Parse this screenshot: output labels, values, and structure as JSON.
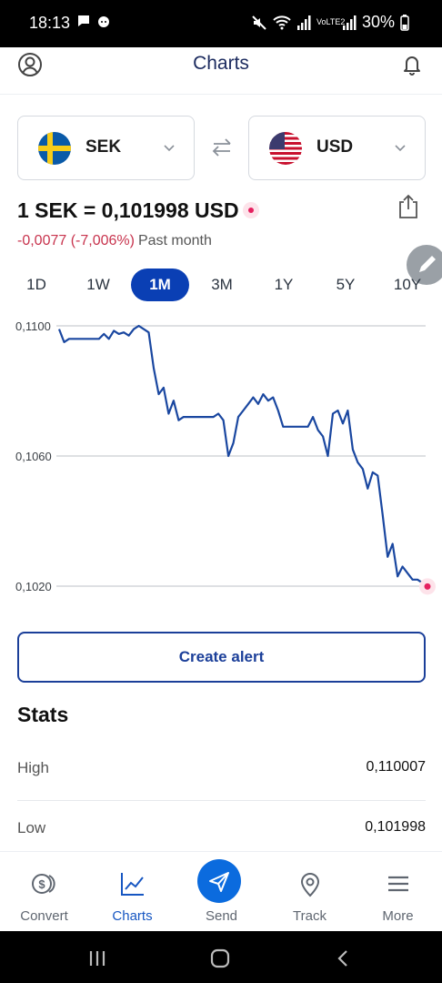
{
  "status_bar": {
    "time": "18:13",
    "battery": "30%",
    "network_label": "VoLTE2"
  },
  "header": {
    "title": "Charts"
  },
  "converter": {
    "from_currency": "SEK",
    "to_currency": "USD"
  },
  "rate": {
    "text": "1 SEK = 0,101998 USD",
    "change": "-0,0077 (-7,006%)",
    "period_label": "Past month"
  },
  "tabs": [
    {
      "label": "1D",
      "active": false
    },
    {
      "label": "1W",
      "active": false
    },
    {
      "label": "1M",
      "active": true
    },
    {
      "label": "3M",
      "active": false
    },
    {
      "label": "1Y",
      "active": false
    },
    {
      "label": "5Y",
      "active": false
    },
    {
      "label": "10Y",
      "active": false
    }
  ],
  "chart_data": {
    "type": "line",
    "ylim": [
      0.102,
      0.11
    ],
    "yticks": [
      "0,1100",
      "0,1060",
      "0,1020"
    ],
    "ytick_values": [
      0.11,
      0.106,
      0.102
    ],
    "series": [
      {
        "color": "#1a47a0",
        "values": [
          0.1099,
          0.1095,
          0.1096,
          0.1096,
          0.1096,
          0.1096,
          0.1096,
          0.1096,
          0.1096,
          0.10975,
          0.1096,
          0.10985,
          0.10975,
          0.1098,
          0.1097,
          0.1099,
          0.11,
          0.1099,
          0.1098,
          0.1087,
          0.1079,
          0.1081,
          0.1073,
          0.1077,
          0.1071,
          0.1072,
          0.1072,
          0.1072,
          0.1072,
          0.1072,
          0.1072,
          0.1072,
          0.1073,
          0.1071,
          0.106,
          0.1064,
          0.1072,
          0.1074,
          0.1076,
          0.1078,
          0.1076,
          0.1079,
          0.1077,
          0.1078,
          0.1074,
          0.1069,
          0.1069,
          0.1069,
          0.1069,
          0.1069,
          0.1069,
          0.1072,
          0.1068,
          0.1066,
          0.106,
          0.1073,
          0.1074,
          0.107,
          0.1074,
          0.1062,
          0.1058,
          0.1056,
          0.105,
          0.1055,
          0.1054,
          0.1042,
          0.1029,
          0.1033,
          0.1023,
          0.1026,
          0.1024,
          0.1022,
          0.1022,
          0.1021,
          0.10199
        ]
      }
    ],
    "last_point_marker_color": "#e5205f"
  },
  "actions": {
    "create_alert": "Create alert"
  },
  "stats": {
    "title": "Stats",
    "rows": [
      {
        "label": "High",
        "value": "0,110007"
      },
      {
        "label": "Low",
        "value": "0,101998"
      }
    ]
  },
  "bottom_nav": [
    {
      "label": "Convert",
      "icon": "convert-coins-icon",
      "active": false
    },
    {
      "label": "Charts",
      "icon": "chart-icon",
      "active": true
    },
    {
      "label": "Send",
      "icon": "send-icon",
      "active": false
    },
    {
      "label": "Track",
      "icon": "location-pin-icon",
      "active": false
    },
    {
      "label": "More",
      "icon": "menu-icon",
      "active": false
    }
  ],
  "colors": {
    "brand": "#0a3fb4",
    "line": "#1a47a0",
    "negative": "#c8344e",
    "send_button": "#0b6bde"
  }
}
